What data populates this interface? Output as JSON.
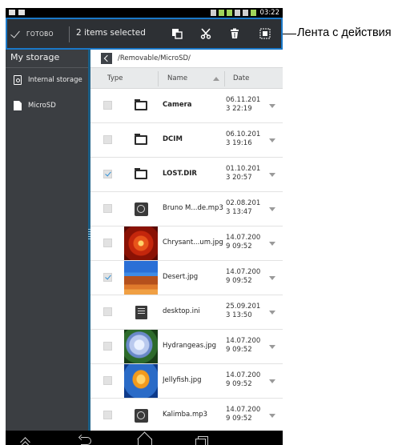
{
  "status_bar": {
    "time": "03:22",
    "left_icons": [
      "image-icon",
      "notification-icon"
    ],
    "right_icons": [
      "vibrate-icon",
      "sync-icon",
      "app-icon",
      "sd-icon",
      "signal-icon",
      "battery-icon"
    ]
  },
  "action_bar": {
    "done_label": "ГОТОВО",
    "done_icon": "checkmark-icon",
    "selection_text": "2 items selected",
    "actions": [
      {
        "name": "copy",
        "icon": "copy-icon"
      },
      {
        "name": "cut",
        "icon": "scissors-icon"
      },
      {
        "name": "delete",
        "icon": "trash-icon"
      },
      {
        "name": "select-all",
        "icon": "select-all-icon"
      }
    ],
    "border_color": "#1a78c8"
  },
  "annotation": {
    "label": "Лента с действия"
  },
  "sidebar": {
    "title": "My storage",
    "items": [
      {
        "label": "Internal storage",
        "icon": "internal-storage-icon"
      },
      {
        "label": "MicroSD",
        "icon": "sd-card-icon"
      }
    ]
  },
  "content": {
    "path": "/Removable/MicroSD/",
    "columns": {
      "type": "Type",
      "name": "Name",
      "date": "Date"
    },
    "sort": {
      "column": "Name",
      "direction": "ascending"
    },
    "files": [
      {
        "name": "Camera",
        "date": "06.11.2013 22:19",
        "type": "folder",
        "checked": false,
        "bold": true
      },
      {
        "name": "DCIM",
        "date": "06.10.2013 19:16",
        "type": "folder",
        "checked": false,
        "bold": true
      },
      {
        "name": "LOST.DIR",
        "date": "01.10.2013 20:57",
        "type": "folder",
        "checked": true,
        "bold": true
      },
      {
        "name": "Bruno M...de.mp3",
        "date": "02.08.2013 13:47",
        "type": "audio",
        "checked": false,
        "bold": false
      },
      {
        "name": "Chrysant...um.jpg",
        "date": "14.07.2009 09:52",
        "type": "photo-flower",
        "checked": false,
        "bold": false
      },
      {
        "name": "Desert.jpg",
        "date": "14.07.2009 09:52",
        "type": "photo-desert",
        "checked": true,
        "bold": false
      },
      {
        "name": "desktop.ini",
        "date": "25.09.2013 13:50",
        "type": "ini",
        "checked": false,
        "bold": false
      },
      {
        "name": "Hydrangeas.jpg",
        "date": "14.07.2009 09:52",
        "type": "photo-hydrangea",
        "checked": false,
        "bold": false
      },
      {
        "name": "Jellyfish.jpg",
        "date": "14.07.2009 09:52",
        "type": "photo-jellyfish",
        "checked": false,
        "bold": false
      },
      {
        "name": "Kalimba.mp3",
        "date": "14.07.2009 09:52",
        "type": "audio",
        "checked": false,
        "bold": false
      }
    ]
  },
  "nav_bar": {
    "buttons": [
      {
        "name": "up",
        "icon": "chevron-up-icon"
      },
      {
        "name": "back",
        "icon": "back-icon"
      },
      {
        "name": "home",
        "icon": "home-icon"
      },
      {
        "name": "recent-apps",
        "icon": "recent-apps-icon"
      }
    ]
  },
  "colors": {
    "sidebar_bg": "#3b3e42",
    "action_bar_bg": "#2d3034",
    "accent": "#2e8fd6"
  }
}
